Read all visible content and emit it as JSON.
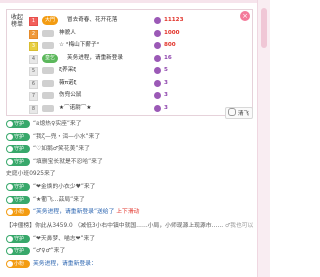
{
  "rank_panel": {
    "title": "Tiěníān băngdān",
    "close_label": "×",
    "rows": [
      {
        "rank": "1",
        "badge": "大門",
        "name": "冒去奇春、花开花落",
        "score": "11123"
      },
      {
        "rank": "2",
        "badge": "",
        "name": "神貌人",
        "score": "1000"
      },
      {
        "rank": "3",
        "badge": "",
        "name": "☆ °梅山下薪子°",
        "score": "800"
      },
      {
        "rank": "4",
        "badge": "皇乞",
        "name": "芙务进程，请重新登录",
        "score": "16"
      },
      {
        "rank": "5",
        "badge": "",
        "name": "ξ养采ξ",
        "score": "5"
      },
      {
        "rank": "6",
        "badge": "",
        "name": "薇π诺ξ",
        "score": "3"
      },
      {
        "rank": "7",
        "badge": "",
        "name": "伤兜公鼠",
        "score": "3"
      },
      {
        "rank": "8",
        "badge": "",
        "name": "★⌒诺尉⌒★",
        "score": "3"
      }
    ]
  },
  "rank_toggle": {
    "label": "清飞"
  },
  "feed": [
    {
      "type": "guard",
      "badge": "守护",
      "text": "“อ熄热♀实座”来了"
    },
    {
      "type": "guard",
      "badge": "守护",
      "text": "“我ζ—兜・洱—小水”来了"
    },
    {
      "type": "guard",
      "badge": "守护",
      "text": "“♡如鹅♂笑花美”来了"
    },
    {
      "type": "guard",
      "badge": "守护",
      "text": "“填删宝长就是不忍哈”来了"
    },
    {
      "type": "plain",
      "text": "史庭小班0925来了"
    },
    {
      "type": "guard",
      "badge": "守护",
      "text": "“❤金焕的小衣少♥”来了"
    },
    {
      "type": "guard",
      "badge": "守护",
      "text": "“★衢飞…茲局”来了"
    },
    {
      "type": "anchor",
      "badge": "小粉",
      "text": "“芙务进程，请重新登录”送给了",
      "highlight": "上下滑动"
    },
    {
      "type": "notice",
      "text": "【冲僵榜】你此从3459.0 （减低3小右中镇中就国……小局，小师现源上现源市……",
      "grey": "♂我也可以"
    },
    {
      "type": "guard",
      "badge": "守护",
      "text": "“❤天鼻梦、喵志❤”来了"
    },
    {
      "type": "guard",
      "badge": "守护",
      "text": "“♂♀♂”来了"
    },
    {
      "type": "anchor",
      "badge": "小粉",
      "text": "芙务进程，请重新登录：",
      "highlight": ""
    }
  ]
}
